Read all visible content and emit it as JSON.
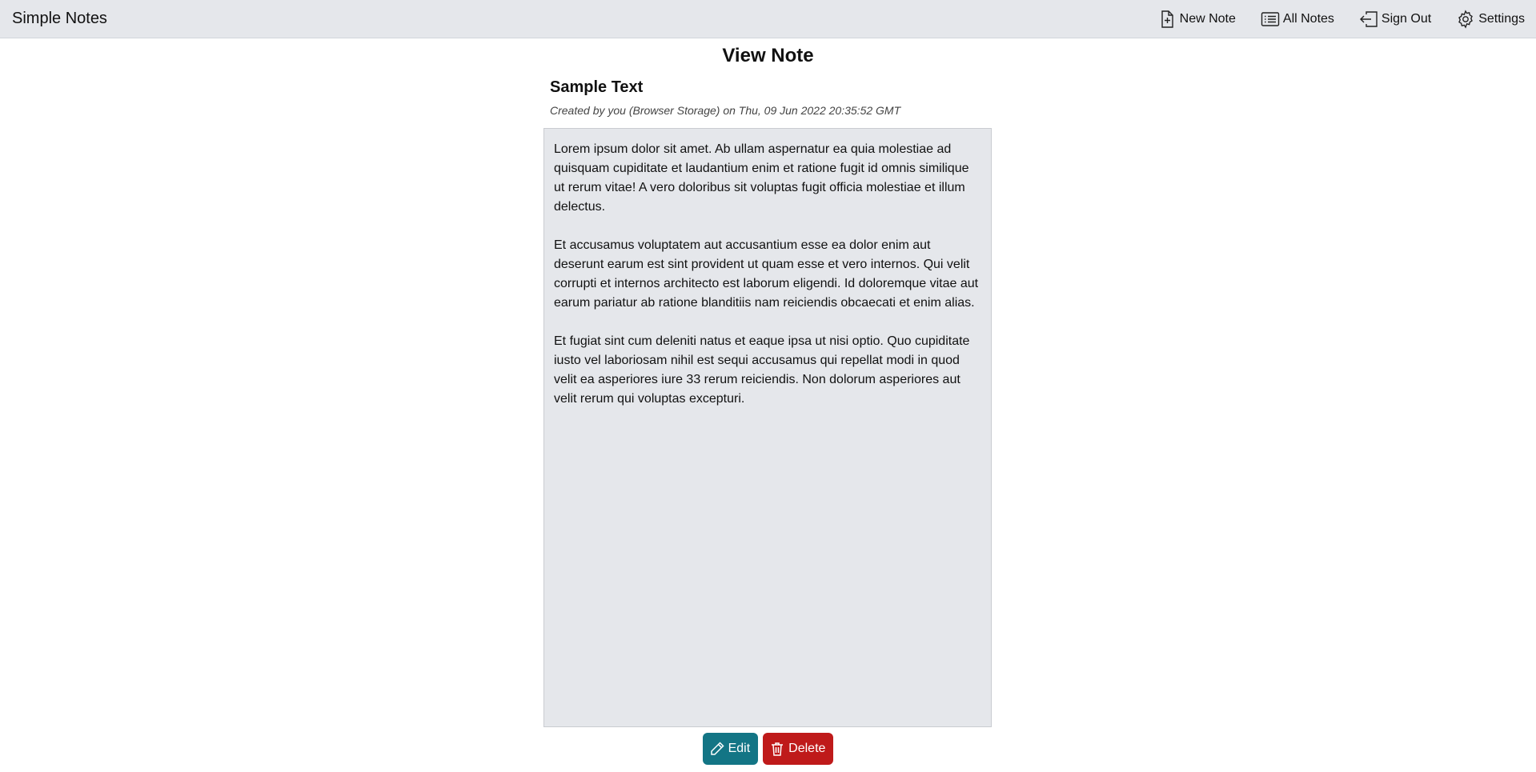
{
  "app": {
    "title": "Simple Notes"
  },
  "nav": {
    "new_note": {
      "label": "New Note",
      "icon": "file-plus-icon"
    },
    "all_notes": {
      "label": "All Notes",
      "icon": "list-icon"
    },
    "sign_out": {
      "label": "Sign Out",
      "icon": "sign-out-icon"
    },
    "settings": {
      "label": "Settings",
      "icon": "gear-icon"
    }
  },
  "page": {
    "heading": "View Note"
  },
  "note": {
    "title": "Sample Text",
    "meta": "Created by you (Browser Storage) on Thu, 09 Jun 2022 20:35:52 GMT",
    "paragraphs": [
      "Lorem ipsum dolor sit amet. Ab ullam aspernatur ea quia molestiae ad quisquam cupiditate et laudantium enim et ratione fugit id omnis similique ut rerum vitae! A vero doloribus sit voluptas fugit officia molestiae et illum delectus.",
      "Et accusamus voluptatem aut accusantium esse ea dolor enim aut deserunt earum est sint provident ut quam esse et vero internos. Qui velit corrupti et internos architecto est laborum eligendi. Id doloremque vitae aut earum pariatur ab ratione blanditiis nam reiciendis obcaecati et enim alias.",
      "Et fugiat sint cum deleniti natus et eaque ipsa ut nisi optio. Quo cupiditate iusto vel laboriosam nihil est sequi accusamus qui repellat modi in quod velit ea asperiores iure 33 rerum reiciendis. Non dolorum asperiores aut velit rerum qui voluptas excepturi."
    ]
  },
  "actions": {
    "edit": {
      "label": "Edit",
      "icon": "pencil-icon",
      "color": "#137585"
    },
    "delete": {
      "label": "Delete",
      "icon": "trash-icon",
      "color": "#bf1a1a"
    }
  }
}
